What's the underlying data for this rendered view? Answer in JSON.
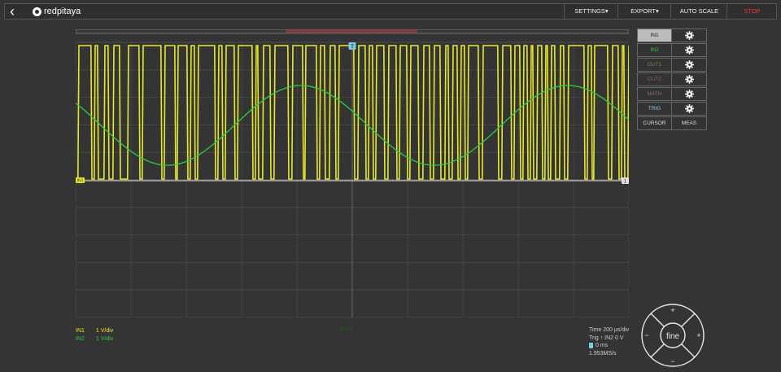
{
  "topbar": {
    "brand": "redpitaya",
    "menu": {
      "settings": "SETTINGS▾",
      "export": "EXPORT▾",
      "autoscale": "AUTO SCALE",
      "stop": "STOP"
    }
  },
  "plot": {
    "trigger_marker": "T",
    "in1_marker": "IN1",
    "right_marker": "1"
  },
  "side": {
    "channels": [
      {
        "label": "IN1",
        "color": "#222222",
        "active": true
      },
      {
        "label": "IN2",
        "color": "#2ecc40"
      },
      {
        "label": "OUT1",
        "color": "#8a7a4a"
      },
      {
        "label": "OUT2",
        "color": "#8a5a5a"
      },
      {
        "label": "MATH",
        "color": "#8a6a8a"
      },
      {
        "label": "TRIG",
        "color": "#7ecbe8"
      }
    ],
    "cursor": "CURSOR",
    "meas": "MEAS"
  },
  "channel_info": {
    "in1_name": "IN1",
    "in1_scale": "1 V/div",
    "in1_color": "#e8e82a",
    "in2_name": "IN2",
    "in2_scale": "1 V/div",
    "in2_color": "#2ecc40"
  },
  "status": {
    "auto": "AUTO"
  },
  "time_info": {
    "time": "Time 200 µs/div",
    "trig": "Trig ↑ IN2 0 V",
    "offset": "0 ms",
    "rate": "1.953MS/s"
  },
  "nav_pad": {
    "center": "fine",
    "up": "+",
    "down": "−",
    "left": "−",
    "right": "+"
  },
  "colors": {
    "background": "#343434",
    "in1": "#e8e82a",
    "in2": "#2ecc40",
    "trigger": "#7ecbe8",
    "stop": "#e33333"
  }
}
